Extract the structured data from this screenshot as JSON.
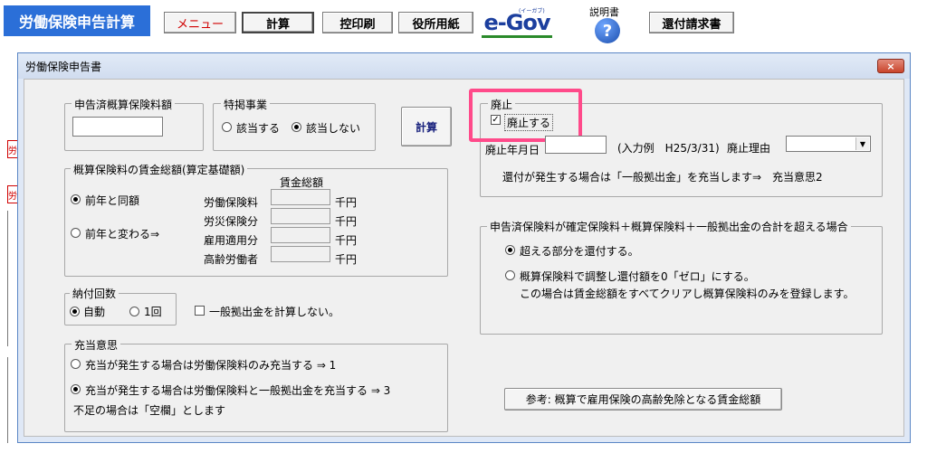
{
  "toolbar": {
    "app_title": "労働保険申告計算",
    "menu_label": "メニュー",
    "calc_label": "計算",
    "copy_print_label": "控印刷",
    "office_paper_label": "役所用紙",
    "egov_label": "e-Gov",
    "egov_sub": "(イーガブ)",
    "manual_label": "説明書",
    "help_glyph": "?",
    "refund_label": "還付請求書"
  },
  "sheet": {
    "red1": "労",
    "red2": "労"
  },
  "dialog": {
    "title": "労働保険申告書",
    "close_glyph": "×"
  },
  "declared_premium": {
    "legend": "申告済概算保険料額",
    "value": ""
  },
  "special_business": {
    "legend": "特掲事業",
    "applies": "該当する",
    "not_applies": "該当しない",
    "selected": "not_applies"
  },
  "calc_button": "計算",
  "wage_total": {
    "legend": "概算保険料の賃金総額(算定基礎額)",
    "header": "賃金総額",
    "same_as_prev": "前年と同額",
    "changed": "前年と変わる⇒",
    "selected": "same_as_prev",
    "rows": [
      {
        "label": "労働保険料",
        "value": "",
        "unit": "千円"
      },
      {
        "label": "労災保険分",
        "value": "",
        "unit": "千円"
      },
      {
        "label": "雇用適用分",
        "value": "",
        "unit": "千円"
      },
      {
        "label": "高齢労働者",
        "value": "",
        "unit": "千円"
      }
    ]
  },
  "installments": {
    "legend": "納付回数",
    "auto": "自動",
    "once": "1回",
    "selected": "auto"
  },
  "no_general_contribution": {
    "label": "一般拠出金を計算しない。",
    "checked": false
  },
  "allocation": {
    "legend": "充当意思",
    "option1": "充当が発生する場合は労働保険料のみ充当する ⇒ 1",
    "option3": "充当が発生する場合は労働保険料と一般拠出金を充当する ⇒ 3",
    "selected": "option3",
    "note": "不足の場合は「空欄」とします"
  },
  "abolition": {
    "legend": "廃止",
    "checkbox_label": "廃止する",
    "checked": true,
    "check_glyph": "✓",
    "date_label": "廃止年月日",
    "date_value": "",
    "date_example": "(入力例　H25/3/31)",
    "reason_label": "廃止理由",
    "reason_value": "",
    "combo_arrow": "▼",
    "refund_note": "還付が発生する場合は「一般拠出金」を充当します⇒　充当意思2"
  },
  "exceed": {
    "legend": "申告済保険料が確定保険料＋概算保険料＋一般拠出金の合計を超える場合",
    "option1": "超える部分を還付する。",
    "option2": "概算保険料で調整し還付額を0「ゼロ」にする。",
    "option2_note": "この場合は賃金総額をすべてクリアし概算保険料のみを登録します。",
    "selected": "option1"
  },
  "reference_button": "参考:  概算で雇用保険の高齢免除となる賃金総額"
}
